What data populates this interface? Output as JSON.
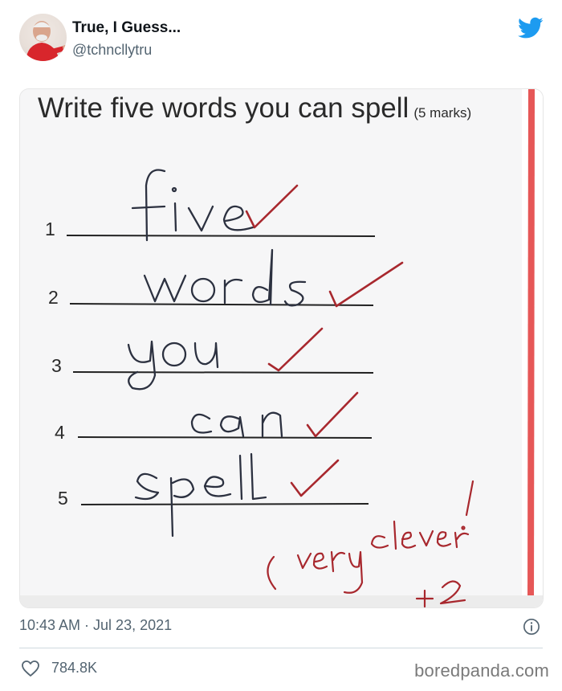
{
  "tweet": {
    "author": {
      "display_name": "True, I Guess...",
      "handle": "@tchncllytru",
      "avatar_icon": "avatar-man-icon"
    },
    "platform_icon": "twitter-bird-icon",
    "brand_color": "#1d9bf0",
    "timestamp": "10:43 AM · Jul 23, 2021",
    "info_icon": "info-icon",
    "likes": {
      "icon": "heart-icon",
      "count": "784.8K"
    }
  },
  "worksheet": {
    "title": "Write five words you can spell",
    "marks": "(5 marks)",
    "line_numbers": [
      "1",
      "2",
      "3",
      "4",
      "5"
    ],
    "answers": [
      "five",
      "words",
      "you",
      "can",
      "spell"
    ],
    "teacher_note": "very clever!",
    "bonus": "+2",
    "ink_color": "#a8282e"
  },
  "watermark": "boredpanda.com"
}
